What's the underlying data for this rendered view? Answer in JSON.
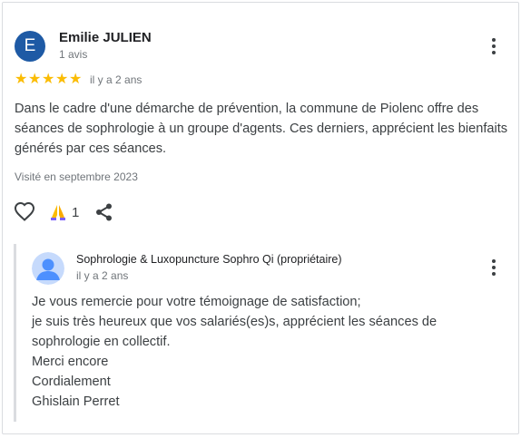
{
  "review": {
    "avatar_letter": "E",
    "avatar_color": "#1e5aa5",
    "author": "Emilie JULIEN",
    "author_meta": "1 avis",
    "rating": 5,
    "rating_max": 5,
    "star_color": "#fbbc04",
    "date": "il y a 2 ans",
    "text": "Dans le cadre d'une démarche de prévention, la commune de Piolenc offre des séances de sophrologie à un groupe d'agents. Ces derniers, apprécient les bienfaits générés par ces séances.",
    "visited": "Visité en septembre 2023",
    "reaction_count": "1",
    "icons": [
      "kebab-menu-icon",
      "like-heart-icon",
      "thanks-hands-icon",
      "share-icon"
    ]
  },
  "owner_reply": {
    "name": "Sophrologie & Luxopuncture Sophro Qi (propriétaire)",
    "date": "il y a 2 ans",
    "lines": [
      "Je vous remercie pour votre témoignage de satisfaction;",
      "je suis très heureux que vos salariés(es)s, apprécient les séances de",
      "sophrologie en collectif.",
      "Merci encore",
      "Cordialement",
      "Ghislain Perret"
    ],
    "icons": [
      "owner-avatar-icon",
      "kebab-menu-icon"
    ]
  }
}
